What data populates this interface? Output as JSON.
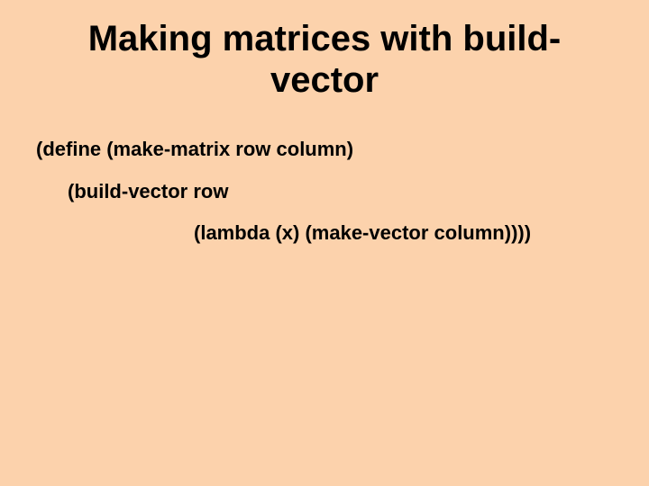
{
  "title": "Making matrices with build-vector",
  "code": {
    "line1": "(define (make-matrix row column)",
    "line2": "(build-vector row",
    "line3": "(lambda (x) (make-vector column))))"
  }
}
